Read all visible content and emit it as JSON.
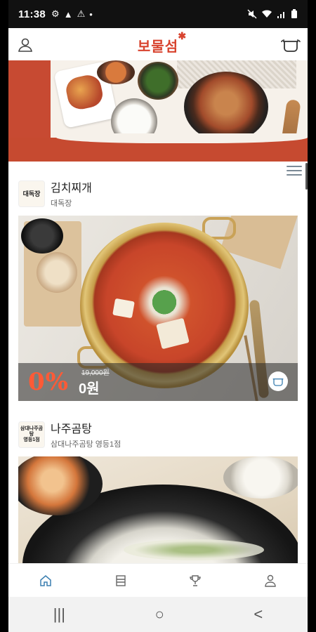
{
  "status_bar": {
    "time": "11:38",
    "left_symbols": [
      "⚙",
      "▲",
      "⚠",
      "•"
    ],
    "right_symbols": [
      "mute-icon",
      "wifi-icon",
      "signal-icon",
      "battery-icon"
    ]
  },
  "header": {
    "logo_text": "보물섬",
    "logo_star": "✱",
    "left_icon": "profile-icon",
    "right_icon": "pot-icon"
  },
  "stores": [
    {
      "logo_text": "대독장",
      "name": "김치찌개",
      "branch": "대독장",
      "discount": "0%",
      "original_price": "19,000원",
      "sale_price": "0원"
    },
    {
      "logo_text": "삼대나주곰탕\n영등1점",
      "name": "나주곰탕",
      "branch": "삼대나주곰탕 영등1점"
    }
  ],
  "tabs": [
    {
      "name": "home",
      "icon": "home-icon",
      "active": true
    },
    {
      "name": "list",
      "icon": "list-icon",
      "active": false
    },
    {
      "name": "trophy",
      "icon": "trophy-icon",
      "active": false
    },
    {
      "name": "profile",
      "icon": "profile-icon",
      "active": false
    }
  ],
  "system_nav": {
    "recent": "|||",
    "home": "○",
    "back": "<"
  },
  "colors": {
    "accent_red": "#d8432e",
    "discount_orange": "#ff5a36",
    "tab_active": "#3b7fb0",
    "icon_gray": "#666666"
  }
}
